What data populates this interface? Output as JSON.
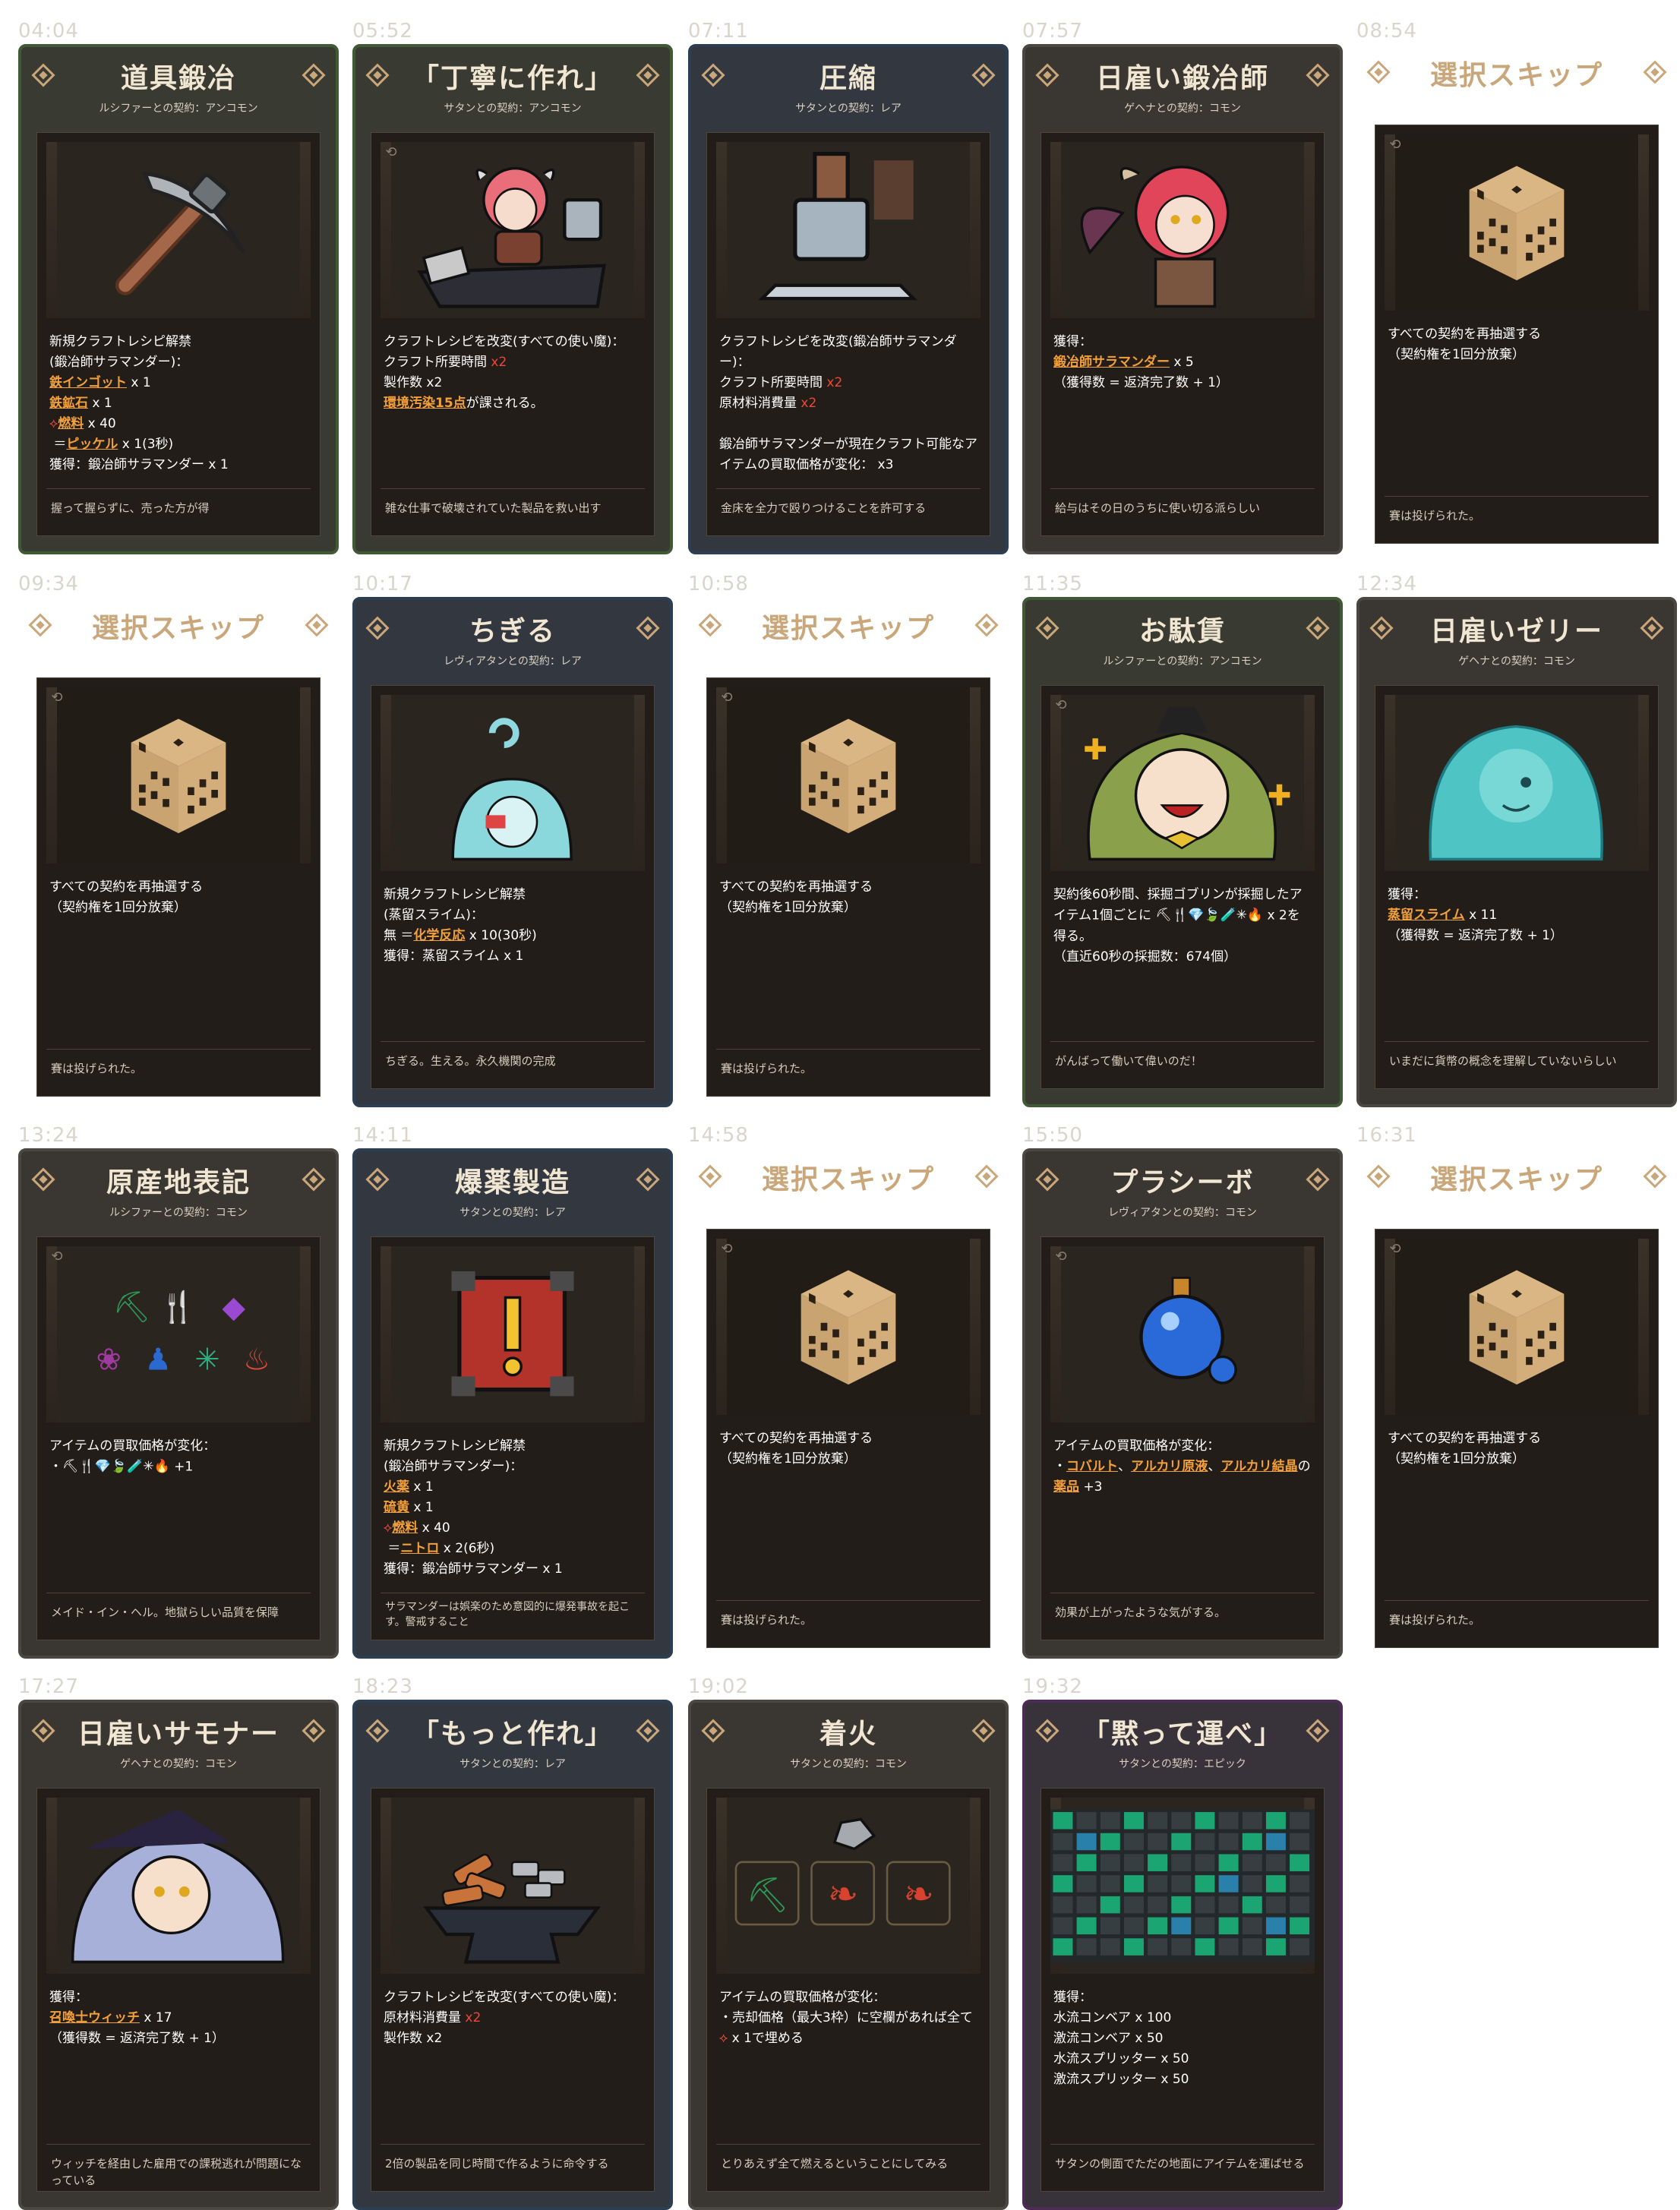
{
  "cards": [
    {
      "time": "04:04",
      "title": "道具鍛冶",
      "sub": "ルシファーとの契約：アンコモン",
      "flavor": "握って握らずに、売った方が得",
      "desc_html": "新規クラフトレシピ解禁\n(鍛冶師サラマンダー)：\n<span class=\"hl\">鉄インゴット</span> x 1\n<span class=\"hl\">鉄鉱石</span> x 1\n<span class=\"red\">⟡</span><span class=\"hl\">燃料</span> x 40\n ＝<span class=\"hl\">ピッケル</span> x 1(3秒)\n獲得：鍛冶師サラマンダー x 1",
      "art": "pickaxe",
      "style": "green"
    },
    {
      "time": "05:52",
      "title": "「丁寧に作れ」",
      "sub": "サタンとの契約：アンコモン",
      "flavor": "雑な仕事で破壊されていた製品を救い出す",
      "desc_html": "クラフトレシピを改変(すべての使い魔)：\nクラフト所要時間 <span class=\"xx\">x2</span>\n製作数 x2\n<span class=\"hl\">環境汚染15点</span>が課される。",
      "art": "girl_anvil",
      "style": "green"
    },
    {
      "time": "07:11",
      "title": "圧縮",
      "sub": "サタンとの契約：レア",
      "flavor": "金床を全力で殴りつけることを許可する",
      "desc_html": "クラフトレシピを改変(鍛冶師サラマンダー)：\nクラフト所要時間 <span class=\"xx\">x2</span>\n原材料消費量 <span class=\"xx\">x2</span>\n\n鍛冶師サラマンダーが現在クラフト可能なアイテムの買取価格が変化： x3",
      "art": "hammer",
      "style": "blue"
    },
    {
      "time": "07:57",
      "title": "日雇い鍛冶師",
      "sub": "ゲヘナとの契約：コモン",
      "flavor": "給与はその日のうちに使い切る派らしい",
      "desc_html": "獲得：\n<span class=\"hl\">鍛冶師サラマンダー</span> x 5\n（獲得数 = 返済完了数 + 1）",
      "art": "girl_red",
      "style": "gray"
    },
    {
      "time": "08:54",
      "title": "選択スキップ",
      "sub": "",
      "flavor": "賽は投げられた。",
      "desc_html": "すべての契約を再抽選する\n（契約権を1回分放棄）",
      "art": "dice",
      "style": "skip"
    },
    {
      "time": "09:34",
      "title": "選択スキップ",
      "sub": "",
      "flavor": "賽は投げられた。",
      "desc_html": "すべての契約を再抽選する\n（契約権を1回分放棄）",
      "art": "dice",
      "style": "skip"
    },
    {
      "time": "10:17",
      "title": "ちぎる",
      "sub": "レヴィアタンとの契約：レア",
      "flavor": "ちぎる。生える。永久機関の完成",
      "desc_html": "新規クラフトレシピ解禁\n(蒸留スライム)：\n無 ＝<span class=\"hl\">化学反応</span> x 10(30秒)\n獲得：蒸留スライム x 1",
      "art": "slime_small",
      "style": "blue"
    },
    {
      "time": "10:58",
      "title": "選択スキップ",
      "sub": "",
      "flavor": "賽は投げられた。",
      "desc_html": "すべての契約を再抽選する\n（契約権を1回分放棄）",
      "art": "dice",
      "style": "skip"
    },
    {
      "time": "11:35",
      "title": "お駄賃",
      "sub": "ルシファーとの契約：アンコモン",
      "flavor": "がんばって働いて偉いのだ！",
      "desc_html": "契約後60秒間、採掘ゴブリンが採掘したアイテム1個ごとに <span class=\"iconrow\">⛏🍴💎🍃🧪✳🔥</span> x 2を得る。\n（直近60秒の採掘数：674個）",
      "art": "goblin",
      "style": "green"
    },
    {
      "time": "12:34",
      "title": "日雇いゼリー",
      "sub": "ゲヘナとの契約：コモン",
      "flavor": "いまだに貨幣の概念を理解していないらしい",
      "desc_html": "獲得：\n<span class=\"hl\">蒸留スライム</span> x 11\n（獲得数 = 返済完了数 + 1）",
      "art": "slime_big",
      "style": "gray"
    },
    {
      "time": "13:24",
      "title": "原産地表記",
      "sub": "ルシファーとの契約：コモン",
      "flavor": "メイド・イン・ヘル。地獄らしい品質を保障",
      "desc_html": "アイテムの買取価格が変化：\n・<span class=\"iconrow\">⛏🍴💎🍃🧪✳🔥</span> +1",
      "art": "icons",
      "style": "gray"
    },
    {
      "time": "14:11",
      "title": "爆薬製造",
      "sub": "サタンとの契約：レア",
      "flavor": "サラマンダーは娯楽のため意図的に爆発事故を起こす。警戒すること",
      "desc_html": "新規クラフトレシピ解禁\n(鍛冶師サラマンダー)：\n<span class=\"hl\">火薬</span> x 1\n<span class=\"hl\">硫黄</span> x 1\n<span class=\"red\">⟡</span><span class=\"hl\">燃料</span> x 40\n ＝<span class=\"hl\">ニトロ</span> x 2(6秒)\n獲得：鍛冶師サラマンダー x 1",
      "art": "crate",
      "style": "blue"
    },
    {
      "time": "14:58",
      "title": "選択スキップ",
      "sub": "",
      "flavor": "賽は投げられた。",
      "desc_html": "すべての契約を再抽選する\n（契約権を1回分放棄）",
      "art": "dice",
      "style": "skip"
    },
    {
      "time": "15:50",
      "title": "プラシーボ",
      "sub": "レヴィアタンとの契約：コモン",
      "flavor": "効果が上がったような気がする。",
      "desc_html": "アイテムの買取価格が変化：\n・<span class=\"hl\">コバルト</span>、<span class=\"hl\">アルカリ原液</span>、<span class=\"hl\">アルカリ結晶</span>の<span class=\"hl\">薬品</span> +3",
      "art": "potion",
      "style": "gray"
    },
    {
      "time": "16:31",
      "title": "選択スキップ",
      "sub": "",
      "flavor": "賽は投げられた。",
      "desc_html": "すべての契約を再抽選する\n（契約権を1回分放棄）",
      "art": "dice",
      "style": "skip"
    },
    {
      "time": "17:27",
      "title": "日雇いサモナー",
      "sub": "ゲヘナとの契約：コモン",
      "flavor": "ウィッチを経由した雇用での課税逃れが問題になっている",
      "desc_html": "獲得：\n<span class=\"hl\">召喚士ウィッチ</span> x 17\n（獲得数 = 返済完了数 + 1）",
      "art": "witch",
      "style": "gray"
    },
    {
      "time": "18:23",
      "title": "「もっと作れ」",
      "sub": "サタンとの契約：レア",
      "flavor": "2倍の製品を同じ時間で作るように命令する",
      "desc_html": "クラフトレシピを改変(すべての使い魔)：\n原材料消費量 <span class=\"xx\">x2</span>\n製作数 x2",
      "art": "anvil_pile",
      "style": "blue"
    },
    {
      "time": "19:02",
      "title": "着火",
      "sub": "サタンとの契約：コモン",
      "flavor": "とりあえず全て燃えるということにしてみる",
      "desc_html": "アイテムの買取価格が変化：\n・売却価格（最大3枠）に空欄があれば全て<span class=\"red\">⟡</span> x 1で埋める",
      "art": "fire_slots",
      "style": "gray"
    },
    {
      "time": "19:32",
      "title": "「黙って運べ」",
      "sub": "サタンとの契約：エピック",
      "flavor": "サタンの側面でただの地面にアイテムを運ばせる",
      "desc_html": "獲得：\n水流コンベア x 100\n激流コンベア x 50\n水流スプリッター x 50\n激流スプリッター x 50",
      "art": "grid",
      "style": "purple"
    }
  ]
}
